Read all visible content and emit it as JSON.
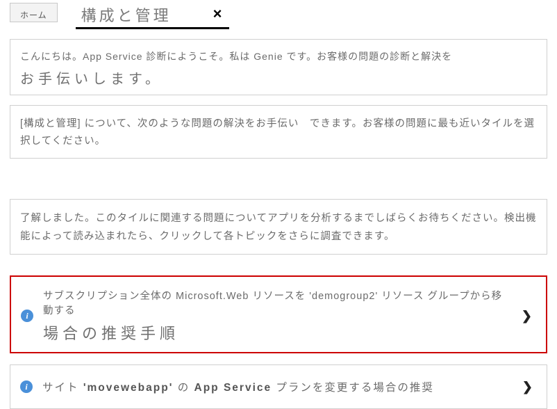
{
  "tabs": {
    "home": "ホーム",
    "active": "構成と管理",
    "close": "×"
  },
  "card1": {
    "line1": "こんにちは。App Service 診断にようこそ。私は Genie です。お客様の問題の診断と解決を",
    "line1b": "お手伝いします。"
  },
  "card2": {
    "text": "[構成と管理] について、次のような問題の解決をお手伝い　できます。お客様の問題に最も近いタイルを選択してください。"
  },
  "card3": {
    "text": "了解しました。このタイルに関連する問題についてアプリを分析するまでしばらくお待ちください。検出機能によって読み込まれたら、クリックして各トピックをさらに調査できます。"
  },
  "result1": {
    "title": "サブスクリプション全体の Microsoft.Web リソースを 'demogroup2' リソース グループから移動する",
    "sub": "場合の推奨手順"
  },
  "result2": {
    "prefix": "サイト ",
    "bold1": "'movewebapp'",
    "mid": " の ",
    "bold2": "App Service",
    "suffix": " プランを変更する場合の推奨"
  },
  "icons": {
    "info": "i",
    "chevron": "❯"
  }
}
